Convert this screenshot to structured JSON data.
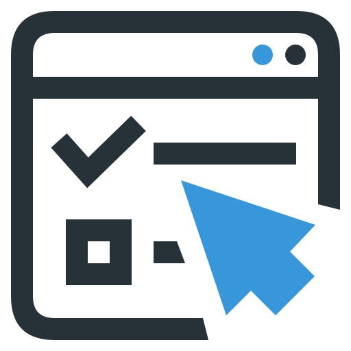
{
  "colors": {
    "outline": "#263238",
    "accent": "#3897DB",
    "background": "#FFFFFF"
  },
  "icon": {
    "name": "web-form-checklist-icon",
    "parts": [
      "browser-window-icon",
      "window-dot-blue-icon",
      "window-dot-dark-icon",
      "checkmark-icon",
      "empty-checkbox-icon",
      "cursor-arrow-icon"
    ]
  }
}
